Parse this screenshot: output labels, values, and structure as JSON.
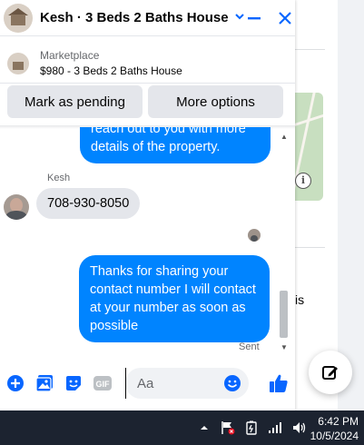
{
  "chat": {
    "title": "Kesh · 3 Beds 2 Baths House",
    "listing_label": "Marketplace",
    "listing_value": "$980 - 3 Beds 2 Baths House",
    "mark_pending_label": "Mark as pending",
    "more_options_label": "More options"
  },
  "messages": {
    "top_message_fragment": "reach out to you with more details of the property.",
    "sender_name": "Kesh",
    "incoming_text": "708-930-8050",
    "outgoing_text": "Thanks for sharing your contact number I will contact at your number as soon as possible",
    "status": "Sent"
  },
  "composer": {
    "placeholder": "Aa"
  },
  "background": {
    "partial_text": "is"
  },
  "taskbar": {
    "time": "6:42 PM",
    "date": "10/5/2024"
  },
  "colors": {
    "messenger_blue": "#0084ff",
    "accent": "#0866ff",
    "bubble_gray": "#e4e6eb",
    "taskbar": "#1c2330"
  }
}
